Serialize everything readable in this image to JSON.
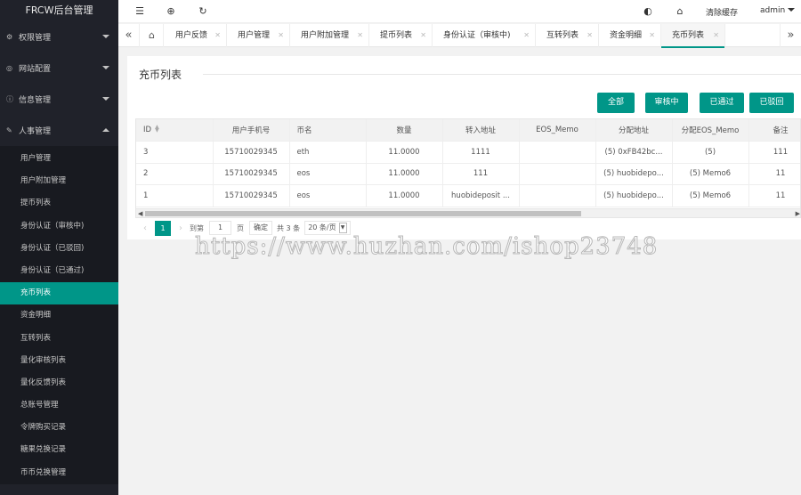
{
  "app": {
    "title": "FRCW后台管理"
  },
  "sidebar": {
    "groups": [
      {
        "label": "权限管理",
        "icon": "gear-icon",
        "expanded": false
      },
      {
        "label": "网站配置",
        "icon": "globe-icon",
        "expanded": false
      },
      {
        "label": "信息管理",
        "icon": "info-icon",
        "expanded": false
      },
      {
        "label": "人事管理",
        "icon": "user-edit-icon",
        "expanded": true
      }
    ],
    "items": [
      {
        "label": "用户管理"
      },
      {
        "label": "用户附加管理"
      },
      {
        "label": "提币列表"
      },
      {
        "label": "身份认证（审核中)"
      },
      {
        "label": "身份认证（已驳回)"
      },
      {
        "label": "身份认证（已通过)"
      },
      {
        "label": "充币列表",
        "active": true
      },
      {
        "label": "资金明细"
      },
      {
        "label": "互转列表"
      },
      {
        "label": "量化审核列表"
      },
      {
        "label": "量化反馈列表"
      },
      {
        "label": "总账号管理"
      },
      {
        "label": "令牌购买记录"
      },
      {
        "label": "糖果兑换记录"
      },
      {
        "label": "币币兑换管理"
      }
    ]
  },
  "header": {
    "icons": [
      "collapse-menu-icon",
      "globe-icon",
      "refresh-icon",
      "theme-icon",
      "tag-icon"
    ],
    "clear_cache": "清除缓存",
    "user": "admin"
  },
  "tabs": [
    {
      "label": "用户反馈"
    },
    {
      "label": "用户管理"
    },
    {
      "label": "用户附加管理"
    },
    {
      "label": "提币列表"
    },
    {
      "label": "身份认证（审核中)"
    },
    {
      "label": "互转列表"
    },
    {
      "label": "资金明细"
    },
    {
      "label": "充币列表",
      "active": true
    }
  ],
  "panel": {
    "title": "充币列表",
    "filters": [
      "全部",
      "审核中",
      "已通过",
      "已驳回"
    ]
  },
  "table": {
    "columns": [
      "ID",
      "用户手机号",
      "币名",
      "数量",
      "转入地址",
      "EOS_Memo",
      "分配地址",
      "分配EOS_Memo",
      "备注"
    ],
    "rows": [
      [
        "3",
        "15710029345",
        "eth",
        "11.0000",
        "1111",
        "",
        "(5) 0xFB42bc...",
        "(5)",
        "111"
      ],
      [
        "2",
        "15710029345",
        "eos",
        "11.0000",
        "111",
        "",
        "(5) huobidepo...",
        "(5) Memo6",
        "11"
      ],
      [
        "1",
        "15710029345",
        "eos",
        "11.0000",
        "huobideposit ...",
        "",
        "(5) huobidepo...",
        "(5) Memo6",
        "11"
      ]
    ]
  },
  "pager": {
    "current": "1",
    "goto_label": "到第",
    "goto_value": "1",
    "page_unit": "页",
    "confirm": "确定",
    "total": "共 3 条",
    "page_size": "20 条/页"
  },
  "watermark": "https://www.huzhan.com/ishop23748",
  "colors": {
    "accent": "#009688",
    "sidebar_bg": "#20222a"
  }
}
